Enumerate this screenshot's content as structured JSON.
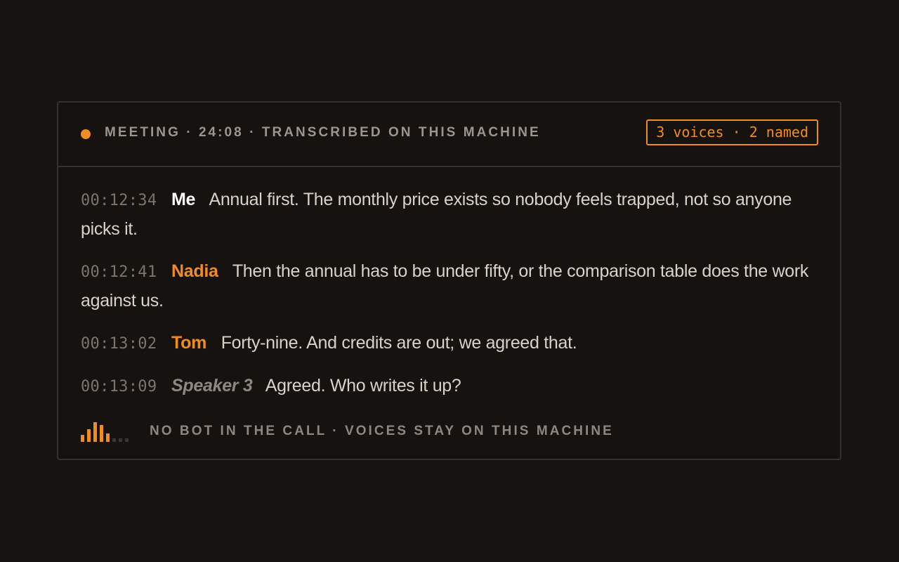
{
  "header": {
    "status": "MEETING · 24:08 · TRANSCRIBED ON THIS MACHINE",
    "badge": "3 voices · 2 named"
  },
  "transcript": [
    {
      "time": "00:12:34",
      "speaker": "Me",
      "text": "Annual first. The monthly price exists so nobody feels trapped, not so anyone picks it."
    },
    {
      "time": "00:12:41",
      "speaker": "Nadia",
      "text": "Then the annual has to be under fifty, or the comparison table does the work against us."
    },
    {
      "time": "00:13:02",
      "speaker": "Tom",
      "text": "Forty-nine. And credits are out; we agreed that."
    },
    {
      "time": "00:13:09",
      "speaker": "Speaker 3",
      "text": "Agreed. Who writes it up?"
    }
  ],
  "footer": {
    "text": "NO BOT IN THE CALL · VOICES STAY ON THIS MACHINE",
    "meter_levels": [
      0.33,
      0.6,
      0.93,
      0.8,
      0.4,
      0.17,
      0.17,
      0.17
    ],
    "meter_active_bars": 5
  },
  "colors": {
    "accent": "#f08c22",
    "background": "#161311",
    "speaker_self": "#ffffff",
    "speaker_named": "#f08c22",
    "speaker_unnamed": "#8e877f",
    "meter_inactive": "#3a3531"
  },
  "icons": {
    "live_indicator": "recording-dot-icon",
    "audio_meter": "audio-level-meter-icon"
  }
}
